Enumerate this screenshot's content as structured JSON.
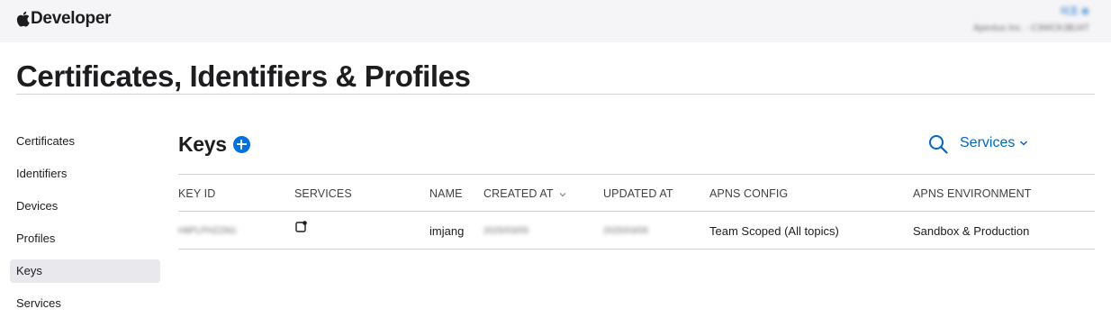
{
  "topbar": {
    "brand": "Developer",
    "account_name": "이조 ⊕",
    "account_team": "Apextus Inc. - C3WCK3BJ4T"
  },
  "page_title": "Certificates, Identifiers & Profiles",
  "sidebar": {
    "items": [
      {
        "label": "Certificates"
      },
      {
        "label": "Identifiers"
      },
      {
        "label": "Devices"
      },
      {
        "label": "Profiles"
      },
      {
        "label": "Keys"
      },
      {
        "label": "Services"
      }
    ]
  },
  "keys": {
    "title": "Keys",
    "services_filter": "Services"
  },
  "table": {
    "headers": {
      "key_id": "KEY ID",
      "services": "SERVICES",
      "name": "NAME",
      "created_at": "CREATED AT",
      "updated_at": "UPDATED AT",
      "apns_config": "APNS CONFIG",
      "apns_environment": "APNS ENVIRONMENT"
    },
    "rows": [
      {
        "key_id": "H8PLPHZZ6G",
        "name": "imjang",
        "created_at": "2025/03/05",
        "updated_at": "2025/03/05",
        "apns_config": "Team Scoped (All topics)",
        "apns_environment": "Sandbox & Production"
      }
    ]
  },
  "colors": {
    "accent": "#0071e3",
    "link": "#0066cc",
    "topbar_bg": "#f5f5f7",
    "active_item_bg": "#e8e8ed"
  },
  "icons": {
    "brand": "apple-logo-icon",
    "add": "plus-circle-icon",
    "search": "search-icon",
    "filter_chevron": "chevron-down-icon",
    "sort": "sort-down-icon",
    "service": "push-notification-icon"
  }
}
